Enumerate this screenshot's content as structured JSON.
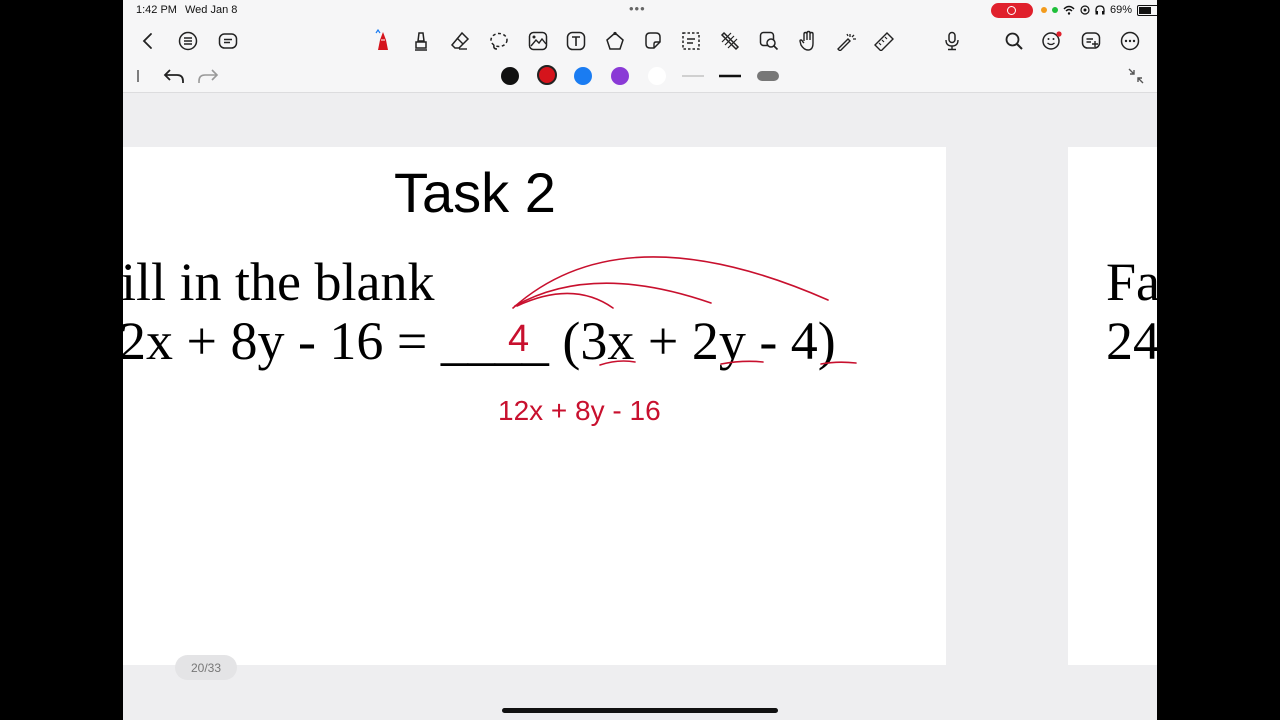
{
  "status_bar": {
    "time": "1:42 PM",
    "date": "Wed Jan 8",
    "battery_percent": "69%"
  },
  "toolbar": {
    "left_icons": [
      "back-icon",
      "outline-icon",
      "page-menu-icon"
    ],
    "tool_icons": [
      "pen-icon",
      "highlighter-icon",
      "eraser-icon",
      "lasso-icon",
      "image-icon",
      "text-icon",
      "shapes-icon",
      "sticker-icon",
      "selection-icon",
      "tape-icon",
      "zoom-window-icon",
      "hand-icon",
      "laser-pointer-icon",
      "ruler-icon"
    ],
    "right_icons": [
      "microphone-icon",
      "search-icon",
      "collaboration-icon",
      "add-page-icon",
      "more-icon"
    ]
  },
  "subbar": {
    "colors": [
      "#111111",
      "#d5141c",
      "#1a7cf2",
      "#8a3ad6",
      "#ffffff"
    ],
    "selected_color": "#d5141c"
  },
  "document": {
    "title": "Task 2",
    "instruction": "ill in the blank",
    "equation_left": "2x + 8y - 16 = ____ (3x + 2y - 4)",
    "handwritten_answer": "4",
    "handwritten_check": "12x + 8y - 16",
    "next_page_line1": "Fa",
    "next_page_line2": "24"
  },
  "page_indicator": "20/33"
}
